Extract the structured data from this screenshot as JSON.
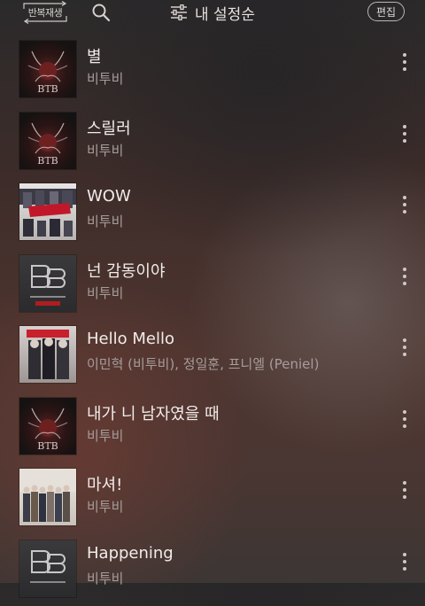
{
  "toolbar": {
    "repeat_label": "반복재생",
    "sort_label": "내 설정순",
    "edit_label": "편집",
    "icons": {
      "search": "search-icon",
      "sort": "sliders-icon",
      "repeat": "repeat-icon",
      "more": "more-vertical-icon"
    }
  },
  "songs": [
    {
      "title": "별",
      "artist": "비투비",
      "cover": "dark-heart"
    },
    {
      "title": "스릴러",
      "artist": "비투비",
      "cover": "dark-heart"
    },
    {
      "title": "WOW",
      "artist": "비투비",
      "cover": "press-play"
    },
    {
      "title": "넌 감동이야",
      "artist": "비투비",
      "cover": "btob-logo"
    },
    {
      "title": "Hello Mello",
      "artist": "이민혁 (비투비), 정일훈, 프니엘 (Peniel)",
      "cover": "hello-mello"
    },
    {
      "title": "내가 니 남자였을 때",
      "artist": "비투비",
      "cover": "dark-heart"
    },
    {
      "title": "마셔!",
      "artist": "비투비",
      "cover": "group-photo"
    },
    {
      "title": "Happening",
      "artist": "비투비",
      "cover": "btob-logo"
    }
  ]
}
